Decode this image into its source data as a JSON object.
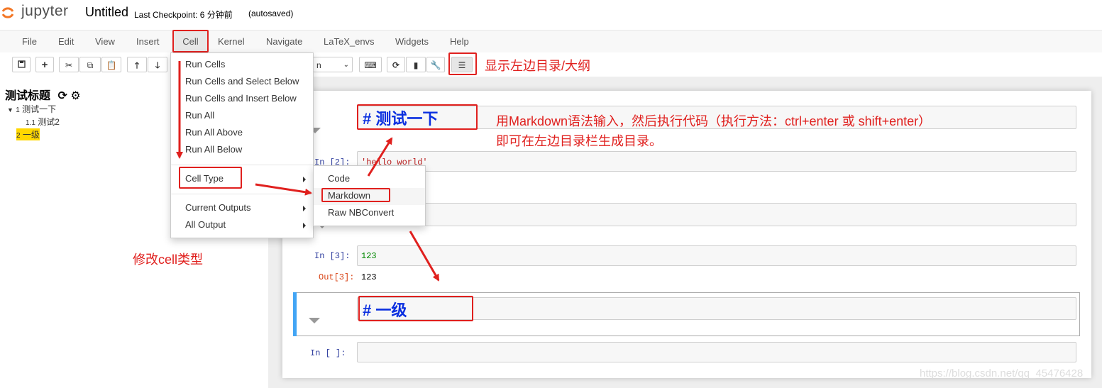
{
  "header": {
    "logo_text": "jupyter",
    "notebook_title": "Untitled",
    "checkpoint": "Last Checkpoint: 6 分钟前",
    "autosaved": "(autosaved)"
  },
  "menubar": {
    "items": [
      "File",
      "Edit",
      "View",
      "Insert",
      "Cell",
      "Kernel",
      "Navigate",
      "LaTeX_envs",
      "Widgets",
      "Help"
    ]
  },
  "toolbar": {
    "celltype_select_value": "n"
  },
  "toc": {
    "title": "测试标题",
    "entries": [
      {
        "num": "1",
        "label": "测试一下"
      },
      {
        "num": "1.1",
        "label": "测试2"
      },
      {
        "num": "2",
        "label": "一级"
      }
    ]
  },
  "cell_menu": {
    "items": [
      "Run Cells",
      "Run Cells and Select Below",
      "Run Cells and Insert Below",
      "Run All",
      "Run All Above",
      "Run All Below",
      "Cell Type",
      "Current Outputs",
      "All Output"
    ]
  },
  "celltype_submenu": {
    "items": [
      "Code",
      "Markdown",
      "Raw NBConvert"
    ]
  },
  "cells": {
    "md1_text": "# 测试一下",
    "code1_prompt": "In  [2]:",
    "code1_text": "'hello world'",
    "code2_prompt": "In  [3]:",
    "code2_text": "123",
    "out2_prompt": "Out[3]:",
    "out2_text": "123",
    "md2_text": "# 一级",
    "empty_prompt": "In  [ ]:"
  },
  "annotations": {
    "toc_toggle": "显示左边目录/大纲",
    "markdown_hint_line1": "用Markdown语法输入，然后执行代码（执行方法：ctrl+enter 或 shift+enter）",
    "markdown_hint_line2": "即可在左边目录栏生成目录。",
    "cell_type_hint": "修改cell类型"
  },
  "watermark": "https://blog.csdn.net/qq_45476428",
  "colors": {
    "annotation_red": "#e0201e",
    "markdown_blue": "#0a2fe0",
    "selected_cell_bar": "#42a5f5",
    "toc_highlight": "#ffd700"
  }
}
